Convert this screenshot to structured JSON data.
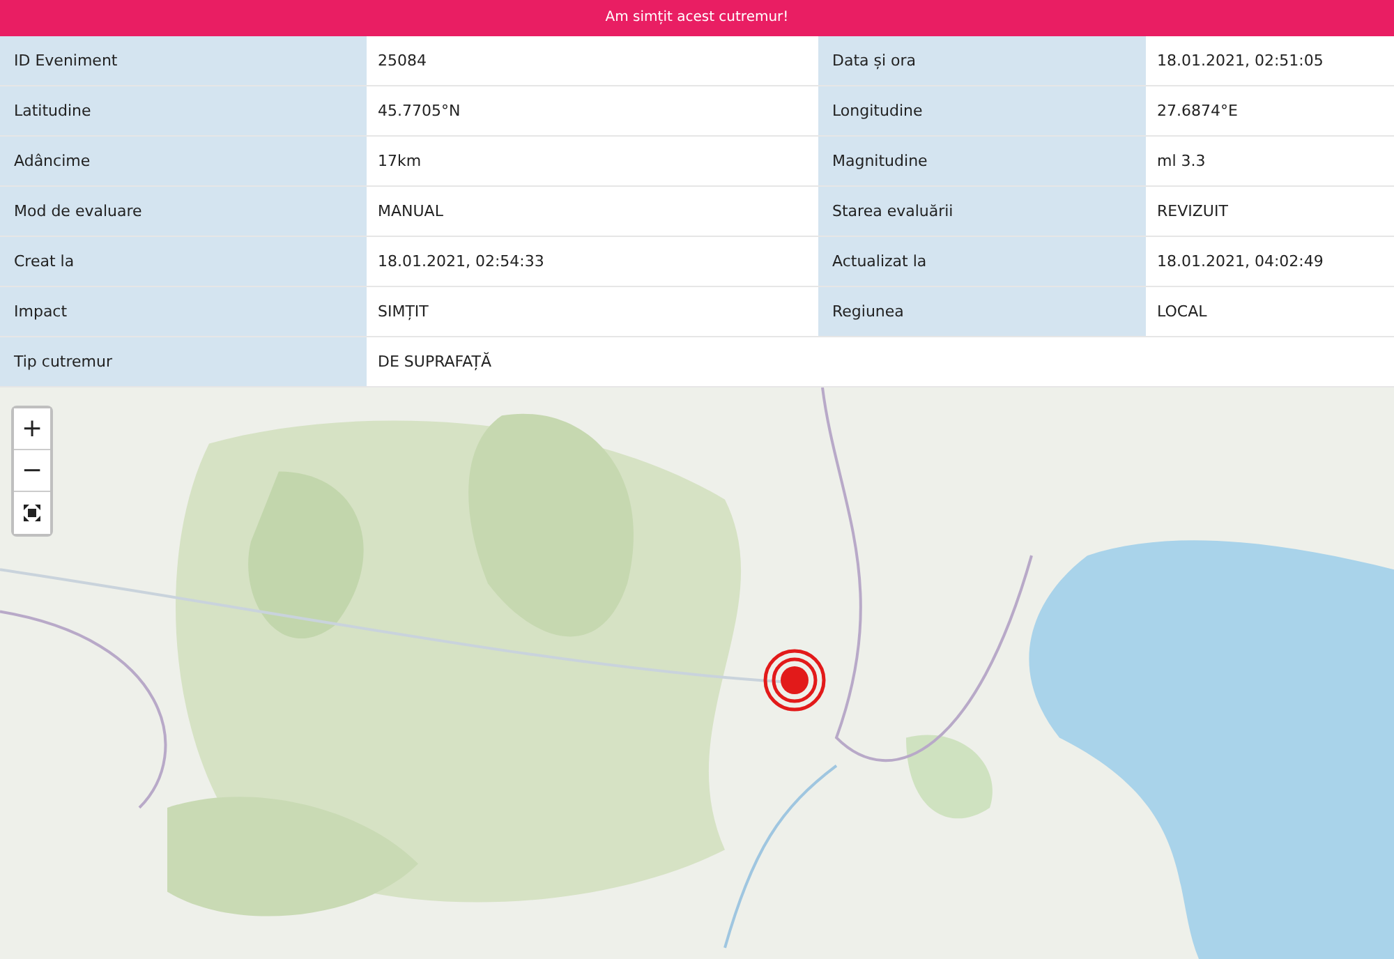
{
  "banner": {
    "text": "Am simțit acest cutremur!"
  },
  "details": [
    {
      "fields": [
        {
          "label": "ID Eveniment",
          "value": "25084"
        },
        {
          "label": "Data și ora",
          "value": "18.01.2021, 02:51:05"
        }
      ]
    },
    {
      "fields": [
        {
          "label": "Latitudine",
          "value": "45.7705°N"
        },
        {
          "label": "Longitudine",
          "value": "27.6874°E"
        }
      ]
    },
    {
      "fields": [
        {
          "label": "Adâncime",
          "value": "17km"
        },
        {
          "label": "Magnitudine",
          "value": "ml 3.3"
        }
      ]
    },
    {
      "fields": [
        {
          "label": "Mod de evaluare",
          "value": "MANUAL"
        },
        {
          "label": "Starea evaluării",
          "value": "REVIZUIT"
        }
      ]
    },
    {
      "fields": [
        {
          "label": "Creat la",
          "value": "18.01.2021, 02:54:33"
        },
        {
          "label": "Actualizat la",
          "value": "18.01.2021, 04:02:49"
        }
      ]
    },
    {
      "fields": [
        {
          "label": "Impact",
          "value": "SIMȚIT"
        },
        {
          "label": "Regiunea",
          "value": "LOCAL"
        }
      ]
    },
    {
      "fields": [
        {
          "label": "Tip cutremur",
          "value": "DE SUPRAFAȚĂ"
        }
      ]
    }
  ],
  "map": {
    "kind": "picture",
    "zoom_in": "+",
    "zoom_out": "−"
  }
}
